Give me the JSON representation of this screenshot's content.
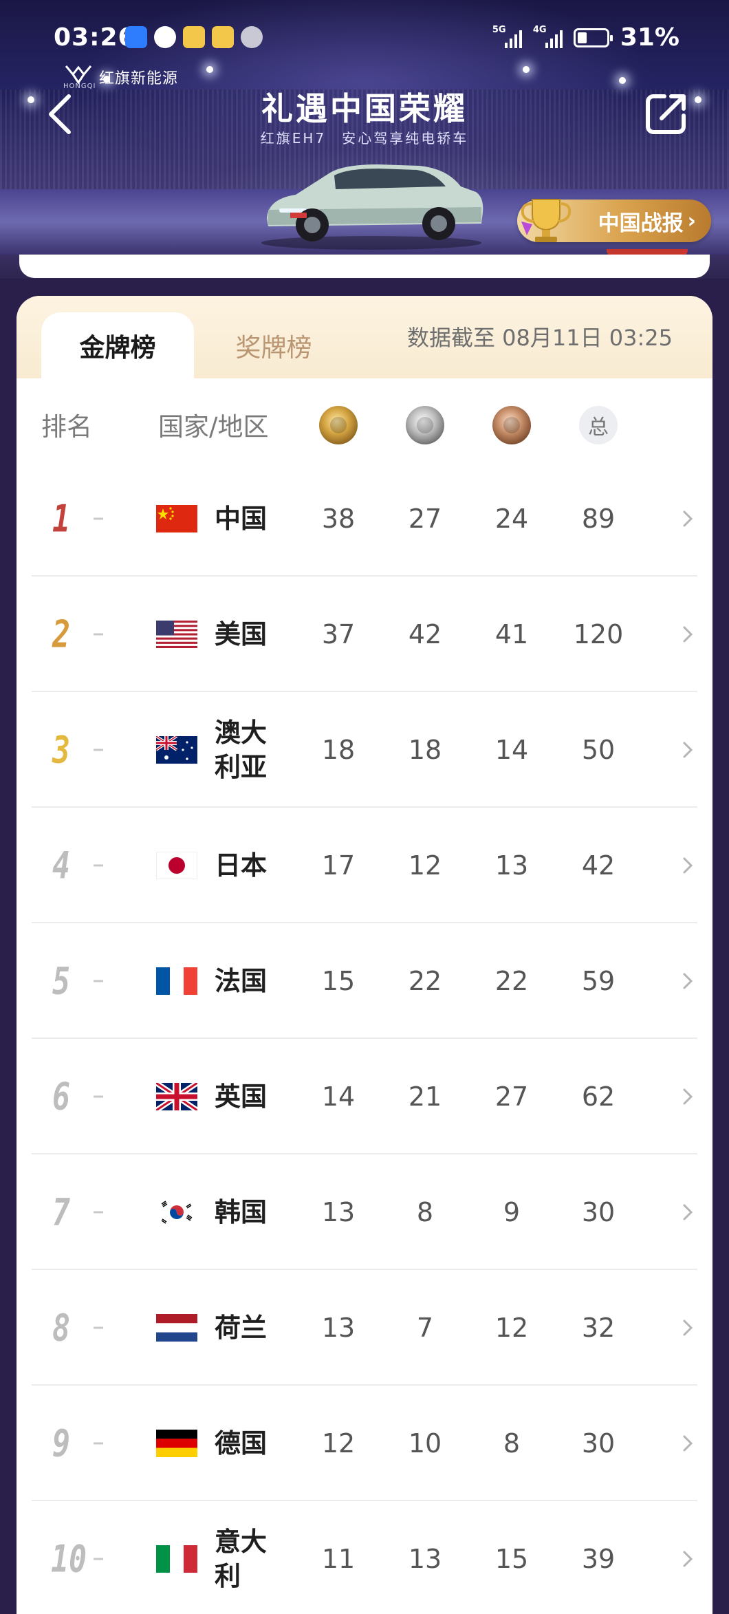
{
  "status_bar": {
    "time": "03:26",
    "network_1": "5G",
    "network_2": "4G",
    "battery": "31%"
  },
  "banner": {
    "brand": "红旗新能源",
    "brand_en": "HONGQI",
    "headline": "礼遇中国荣耀",
    "subline": "红旗EH7　安心驾享纯电轿车",
    "report_button": "中国战报"
  },
  "tabs": {
    "gold_tab": "金牌榜",
    "total_tab": "奖牌榜",
    "updated": "数据截至 08月11日 03:25"
  },
  "columns": {
    "rank": "排名",
    "country": "国家/地区",
    "total_icon": "总"
  },
  "colors": {
    "rank_1": "#c3423c",
    "rank_2": "#d79a3c",
    "rank_3": "#e4b93f",
    "tab_active_text": "#1a1a1a",
    "tab_inactive_text": "#b99571"
  },
  "rows": [
    {
      "rank": "1",
      "trend": "-",
      "flag": "china-flag-icon",
      "country": "中国",
      "gold": "38",
      "silver": "27",
      "bronze": "24",
      "total": "89"
    },
    {
      "rank": "2",
      "trend": "-",
      "flag": "usa-flag-icon",
      "country": "美国",
      "gold": "37",
      "silver": "42",
      "bronze": "41",
      "total": "120"
    },
    {
      "rank": "3",
      "trend": "-",
      "flag": "australia-flag-icon",
      "country": "澳大利亚",
      "gold": "18",
      "silver": "18",
      "bronze": "14",
      "total": "50"
    },
    {
      "rank": "4",
      "trend": "-",
      "flag": "japan-flag-icon",
      "country": "日本",
      "gold": "17",
      "silver": "12",
      "bronze": "13",
      "total": "42"
    },
    {
      "rank": "5",
      "trend": "-",
      "flag": "france-flag-icon",
      "country": "法国",
      "gold": "15",
      "silver": "22",
      "bronze": "22",
      "total": "59"
    },
    {
      "rank": "6",
      "trend": "-",
      "flag": "uk-flag-icon",
      "country": "英国",
      "gold": "14",
      "silver": "21",
      "bronze": "27",
      "total": "62"
    },
    {
      "rank": "7",
      "trend": "-",
      "flag": "korea-flag-icon",
      "country": "韩国",
      "gold": "13",
      "silver": "8",
      "bronze": "9",
      "total": "30"
    },
    {
      "rank": "8",
      "trend": "-",
      "flag": "netherlands-flag-icon",
      "country": "荷兰",
      "gold": "13",
      "silver": "7",
      "bronze": "12",
      "total": "32"
    },
    {
      "rank": "9",
      "trend": "-",
      "flag": "germany-flag-icon",
      "country": "德国",
      "gold": "12",
      "silver": "10",
      "bronze": "8",
      "total": "30"
    },
    {
      "rank": "10",
      "trend": "-",
      "flag": "italy-flag-icon",
      "country": "意大利",
      "gold": "11",
      "silver": "13",
      "bronze": "15",
      "total": "39"
    }
  ]
}
